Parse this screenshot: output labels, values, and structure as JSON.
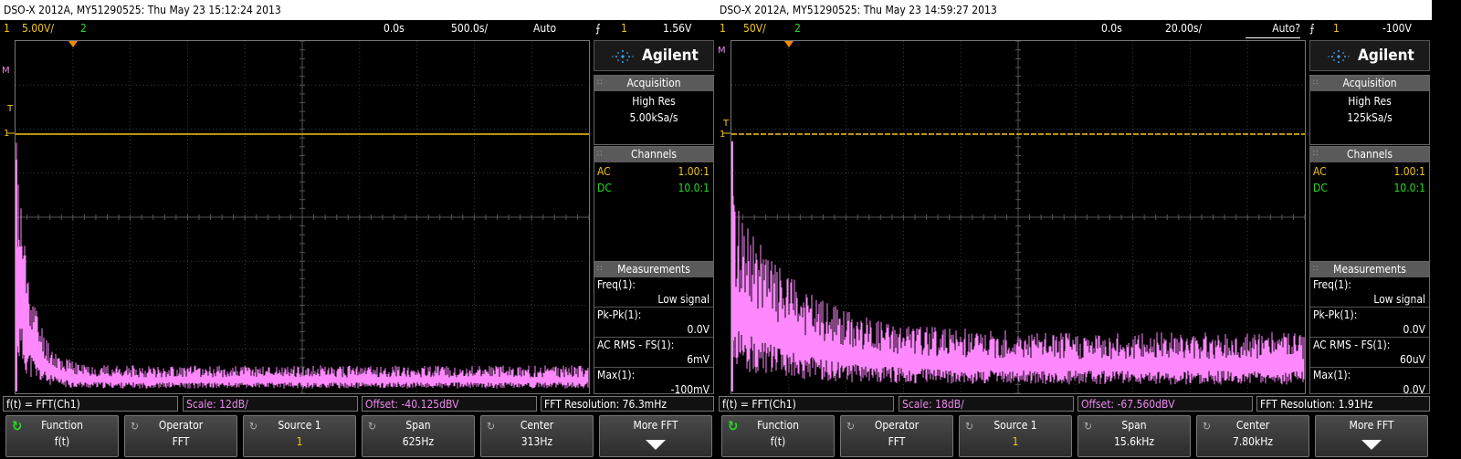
{
  "panels": [
    {
      "title": "DSO-X 2012A, MY51290525: Thu May 23 15:12:24 2013",
      "status": {
        "ch1_num": "1",
        "ch1_scale": "5.00V/",
        "ch2_num": "2",
        "delay": "0.0s",
        "timebase": "500.0s/",
        "trigger_mode": "Auto",
        "trig_src": "1",
        "trig_level": "1.56V"
      },
      "brand": "Agilent",
      "acquisition": {
        "header": "Acquisition",
        "mode": "High Res",
        "rate": "5.00kSa/s"
      },
      "channels": {
        "header": "Channels",
        "rows": [
          {
            "coupling": "AC",
            "probe": "1.00:1"
          },
          {
            "coupling": "DC",
            "probe": "10.0:1"
          }
        ]
      },
      "measurements": {
        "header": "Measurements",
        "items": [
          {
            "label": "Freq(1):",
            "value": "Low signal"
          },
          {
            "label": "Pk-Pk(1):",
            "value": "0.0V"
          },
          {
            "label": "AC RMS - FS(1):",
            "value": "6mV"
          },
          {
            "label": "Max(1):",
            "value": "-100mV"
          }
        ]
      },
      "fft": {
        "func": "f(t) = FFT(Ch1)",
        "scale_label": "Scale:",
        "scale_value": "12dB/",
        "offset_label": "Offset:",
        "offset_value": "-40.125dBV",
        "resolution": "FFT Resolution: 76.3mHz"
      },
      "softkeys": [
        {
          "top": "Function",
          "bottom": "f(t)"
        },
        {
          "top": "Operator",
          "bottom": "FFT"
        },
        {
          "top": "Source 1",
          "bottom": "1"
        },
        {
          "top": "Span",
          "bottom": "625Hz"
        },
        {
          "top": "Center",
          "bottom": "313Hz"
        },
        {
          "top": "More FFT",
          "bottom": ""
        }
      ],
      "markers": {
        "math": "M",
        "trigger": "T",
        "ch1": "1"
      }
    },
    {
      "title": "DSO-X 2012A, MY51290525: Thu May 23 14:59:27 2013",
      "status": {
        "ch1_num": "1",
        "ch1_scale": "50V/",
        "ch2_num": "2",
        "delay": "0.0s",
        "timebase": "20.00s/",
        "trigger_mode": "Auto?",
        "trig_src": "1",
        "trig_level": "-100V"
      },
      "brand": "Agilent",
      "acquisition": {
        "header": "Acquisition",
        "mode": "High Res",
        "rate": "125kSa/s"
      },
      "channels": {
        "header": "Channels",
        "rows": [
          {
            "coupling": "AC",
            "probe": "1.00:1"
          },
          {
            "coupling": "DC",
            "probe": "10.0:1"
          }
        ]
      },
      "measurements": {
        "header": "Measurements",
        "items": [
          {
            "label": "Freq(1):",
            "value": "Low signal"
          },
          {
            "label": "Pk-Pk(1):",
            "value": "0.0V"
          },
          {
            "label": "AC RMS - FS(1):",
            "value": "60uV"
          },
          {
            "label": "Max(1):",
            "value": "0.0V"
          }
        ]
      },
      "fft": {
        "func": "f(t) = FFT(Ch1)",
        "scale_label": "Scale:",
        "scale_value": "18dB/",
        "offset_label": "Offset:",
        "offset_value": "-67.560dBV",
        "resolution": "FFT Resolution: 1.91Hz"
      },
      "softkeys": [
        {
          "top": "Function",
          "bottom": "f(t)"
        },
        {
          "top": "Operator",
          "bottom": "FFT"
        },
        {
          "top": "Source 1",
          "bottom": "1"
        },
        {
          "top": "Span",
          "bottom": "15.6kHz"
        },
        {
          "top": "Center",
          "bottom": "7.80kHz"
        },
        {
          "top": "More FFT",
          "bottom": ""
        }
      ],
      "markers": {
        "math": "M",
        "trigger": "T",
        "ch1": "1"
      }
    }
  ],
  "colors": {
    "ch1_trace": "#f5c518",
    "math_trace": "#ff88ff",
    "ch2": "#22dd22",
    "grid": "#3c3c3c"
  }
}
